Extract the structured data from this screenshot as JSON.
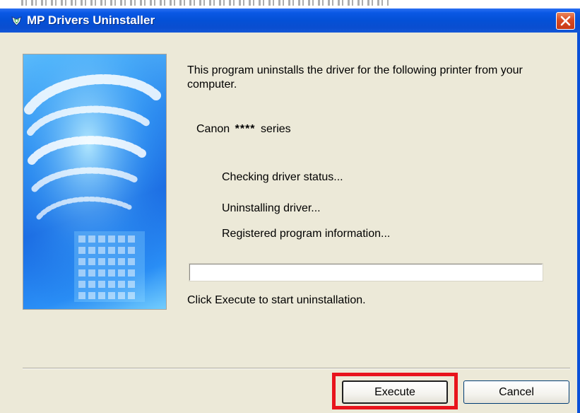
{
  "window": {
    "title": "MP Drivers Uninstaller"
  },
  "content": {
    "intro": "This program uninstalls the driver for the following printer from your computer.",
    "printer_prefix": "Canon",
    "printer_model": "****",
    "printer_suffix": "series",
    "steps": [
      "Checking driver status...",
      "Uninstalling driver...",
      "Registered program information..."
    ],
    "progress": 0,
    "instruction": "Click Execute to start uninstallation."
  },
  "buttons": {
    "execute": "Execute",
    "cancel": "Cancel"
  },
  "icons": {
    "app": "uninstaller-app-icon",
    "close": "close-icon"
  },
  "colors": {
    "titlebar": "#0450d6",
    "close_button": "#d84a22",
    "dialog_background": "#ece9d8",
    "highlight": "#e8141c"
  }
}
